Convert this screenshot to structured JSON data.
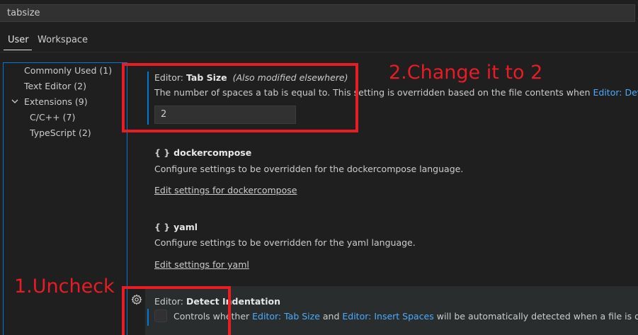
{
  "search": {
    "value": "tabsize"
  },
  "scope_tabs": {
    "user": "User",
    "workspace": "Workspace"
  },
  "toc": {
    "items": [
      {
        "label": "Commonly Used",
        "count": "(1)"
      },
      {
        "label": "Text Editor",
        "count": "(2)"
      },
      {
        "label": "Extensions",
        "count": "(9)"
      },
      {
        "label": "C/C++",
        "count": "(7)"
      },
      {
        "label": "TypeScript",
        "count": "(2)"
      }
    ]
  },
  "tab_size": {
    "category": "Editor: ",
    "name": "Tab Size",
    "modified_note": "(Also modified elsewhere)",
    "description": "The number of spaces a tab is equal to. This setting is overridden based on the file contents when ",
    "description_link": "Editor: Detect Indentation",
    "value": "2"
  },
  "dockercompose": {
    "braces": "{ }",
    "name": "dockercompose",
    "description": "Configure settings to be overridden for the dockercompose language.",
    "link": "Edit settings for dockercompose"
  },
  "yaml": {
    "braces": "{ }",
    "name": "yaml",
    "description": "Configure settings to be overridden for the yaml language.",
    "link": "Edit settings for yaml"
  },
  "detect_indentation": {
    "category": "Editor: ",
    "name": "Detect Indentation",
    "desc_1": "Controls whether ",
    "link_1": "Editor: Tab Size",
    "desc_2": " and ",
    "link_2": "Editor: Insert Spaces",
    "desc_3": " will be automatically detected when a file is opened based on the file contents."
  },
  "annotations": {
    "step_1": "1.Uncheck",
    "step_2": "2.Change it to 2",
    "color": "#e81c25"
  },
  "colors": {
    "background": "#1f1f1f",
    "accent": "#0078d4",
    "link": "#4daafc"
  }
}
